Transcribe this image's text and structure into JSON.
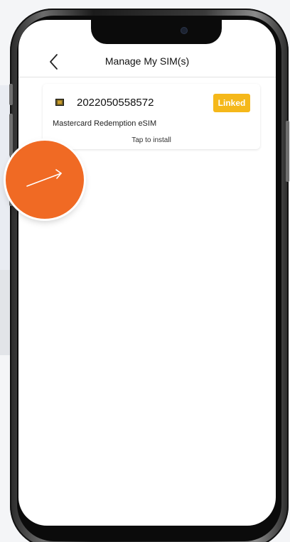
{
  "app": {
    "title": "Manage My SIM(s)"
  },
  "nav": {
    "back_icon": "chevron-left-icon"
  },
  "sim_cards": [
    {
      "number": "2022050558572",
      "status": "Linked",
      "name": "Mastercard Redemption eSIM",
      "action": "Tap to install",
      "icon": "sim-chip-icon"
    }
  ],
  "colors": {
    "accent_badge": "#f5b81a",
    "indicator": "#f06a24"
  },
  "overlay": {
    "icon": "arrow-up-right-icon"
  }
}
